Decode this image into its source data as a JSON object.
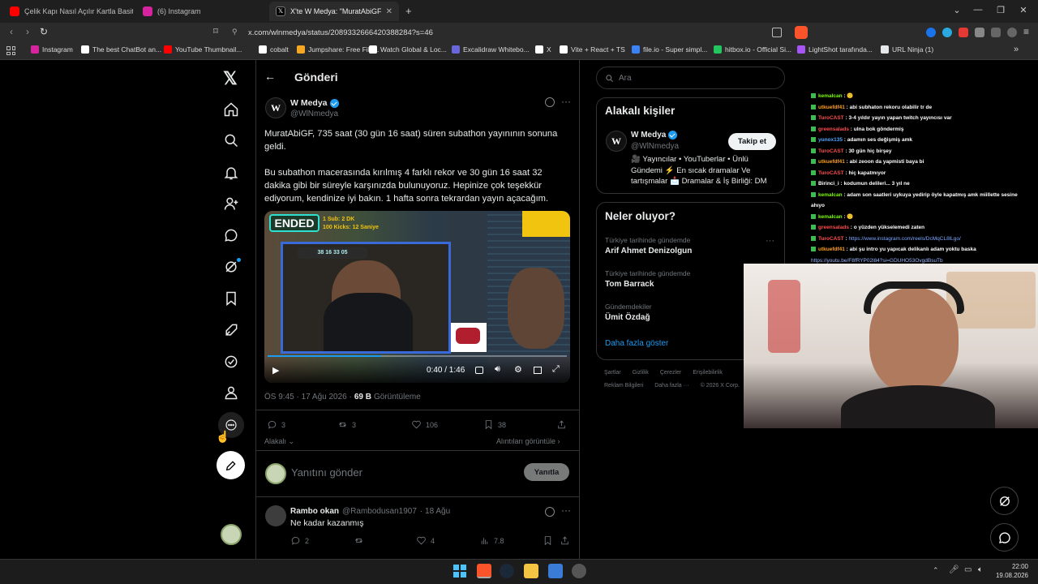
{
  "browser": {
    "tabs": [
      {
        "title": "Çelik Kapı Nasıl Açılır Kartla Basit Yön",
        "color": "#ff0000"
      },
      {
        "title": "(6) Instagram",
        "color": "#d6249f"
      },
      {
        "title": "X'te W Medya: \"MuratAbiGF, 735",
        "color": "#ffffff"
      }
    ],
    "new_tab": "+",
    "url": "x.com/wlnmedya/status/2089332666420388284?s=46",
    "bookmarks": [
      {
        "label": "Instagram",
        "color": "#d6249f"
      },
      {
        "label": "The best ChatBot an...",
        "color": "#ffffff"
      },
      {
        "label": "YouTube Thumbnail...",
        "color": "#ff0000"
      },
      {
        "label": "cobalt",
        "color": "#ffffff"
      },
      {
        "label": "Jumpshare: Free File...",
        "color": "#f5a623"
      },
      {
        "label": "Watch Global & Loc...",
        "color": "#ffffff"
      },
      {
        "label": "Excalidraw Whitebo...",
        "color": "#6965db"
      },
      {
        "label": "X",
        "color": "#ffffff"
      },
      {
        "label": "Vite + React + TS",
        "color": "#ffffff"
      },
      {
        "label": "file.io - Super simpl...",
        "color": "#3b82f6"
      },
      {
        "label": "hitbox.io - Official Si...",
        "color": "#22c55e"
      },
      {
        "label": "LightShot tarafında...",
        "color": "#a855f7"
      },
      {
        "label": "URL Ninja (1)",
        "color": "#e5e7eb"
      }
    ]
  },
  "header": {
    "title": "Gönderi"
  },
  "post": {
    "author": "W Medya",
    "handle": "@WlNmedya",
    "avatar_letter": "W",
    "para1": "MuratAbiGF, 735 saat (30 gün 16 saat) süren subathon yayınının sonuna geldi.",
    "para2": "Bu subathon macerasında kırılmış 4 farklı rekor ve 30 gün 16 saat 32 dakika gibi bir süreyle karşınızda bulunuyoruz. Hepinize çok teşekkür ediyorum, kendinize iyi bakın. 1 hafta sonra tekrardan yayın açacağım.",
    "video": {
      "ended_badge": "ENDED",
      "sub_line1": "1 Sub: 2 DK",
      "sub_line2": "100 Kicks: 12 Saniye",
      "timer": "38 16 33 05",
      "time": "0:40 / 1:46",
      "progress": 0.38
    },
    "timestamp": "ÖS 9:45 · 17 Ağu 2026 ·",
    "views_count": "69 B",
    "views_label": "Görüntüleme",
    "replies": "3",
    "reposts": "3",
    "likes": "106",
    "bookmarks": "38",
    "related_label": "Alakalı",
    "quotes_label": "Alıntıları görüntüle"
  },
  "reply_box": {
    "placeholder": "Yanıtını gönder",
    "button": "Yanıtla"
  },
  "reply": {
    "author": "Rambo okan",
    "handle": "@Rambodusan1907",
    "date": "· 18 Ağu",
    "text": "Ne kadar kazanmış",
    "replies": "2",
    "likes": "4",
    "views": "7.8"
  },
  "search": {
    "placeholder": "Ara"
  },
  "related_people": {
    "title": "Alakalı kişiler",
    "name": "W Medya",
    "handle": "@WlNmedya",
    "follow": "Takip et",
    "bio": "🎥 Yayıncılar • YouTuberlar • Ünlü Gündemi ⚡ En sıcak dramalar Ve tartışmalar 📩 Dramalar & İş Birliği: DM"
  },
  "trends": {
    "title": "Neler oluyor?",
    "items": [
      {
        "meta": "Türkiye tarihinde gündemde",
        "name": "Arif Ahmet Denizolgun"
      },
      {
        "meta": "Türkiye tarihinde gündemde",
        "name": "Tom Barrack"
      },
      {
        "meta": "Gündemdekiler",
        "name": "Ümit Özdağ"
      }
    ],
    "show_more": "Daha fazla göster"
  },
  "footer": {
    "line1": [
      "Şartlar",
      "Gizlilik",
      "Çerezler",
      "Erişilebilirlik"
    ],
    "line2": [
      "Reklam Bilgileri",
      "Daha fazla ···",
      "© 2026 X Corp."
    ]
  },
  "chat": [
    {
      "user": "kemalcan",
      "color": "#7cfc00",
      "msg": "🙂"
    },
    {
      "user": "utkuefdf41",
      "color": "#ff9f1a",
      "msg": "abi subhaton rekoru olabilir tr de"
    },
    {
      "user": "TuroCAST",
      "color": "#ff4d4d",
      "msg": "3-4 yıldır yayın yapan twitch yayıncısı var"
    },
    {
      "user": "greensalads",
      "color": "#ff4d4d",
      "msg": "ulna bok göndermiş"
    },
    {
      "user": "yunox135",
      "color": "#4da6ff",
      "msg": "adamın ses değişmiş amk"
    },
    {
      "user": "TuroCAST",
      "color": "#ff4d4d",
      "msg": "30 gün hiç birşey"
    },
    {
      "user": "utkuefdf41",
      "color": "#ff9f1a",
      "msg": "abi zeoon da yapmisti baya bi"
    },
    {
      "user": "TuroCAST",
      "color": "#ff4d4d",
      "msg": "hiç kapatmıyor"
    },
    {
      "user": "Birinci_i",
      "color": "#ffffff",
      "msg": "kodumun delileri... 3 yıl ne"
    },
    {
      "user": "kemalcan",
      "color": "#7cfc00",
      "msg": "adam son saatleri uykuya yedirip öyle kapatmış amk miillette sesine"
    },
    {
      "user": "",
      "color": "#ffffff",
      "msg": "ahıyo"
    },
    {
      "user": "kemalcan",
      "color": "#7cfc00",
      "msg": "🙂"
    },
    {
      "user": "greensalads",
      "color": "#ff4d4d",
      "msg": "o yüzden yükselemedi zaten"
    },
    {
      "user": "TuroCAST",
      "color": "#ff4d4d",
      "msg": "https://www.instagram.com/reels/DcMqCL8lLgo/"
    },
    {
      "user": "utkuefdf41",
      "color": "#ff9f1a",
      "msg": "abi şu intro yu yapıcak delikanlı adam yoktu baska"
    },
    {
      "user": "",
      "color": "#ffffff",
      "msg": "https://youtu.be/F8fRYP02l84?si=GDUHO53OvgdBsuTb"
    }
  ],
  "taskbar": {
    "time": "22:00",
    "date": "19.08.2026"
  },
  "colors": {
    "accent": "#1d9bf0",
    "bg": "#000000",
    "ended": "#1b3a2a",
    "taskbar": "#1c1c1c"
  }
}
